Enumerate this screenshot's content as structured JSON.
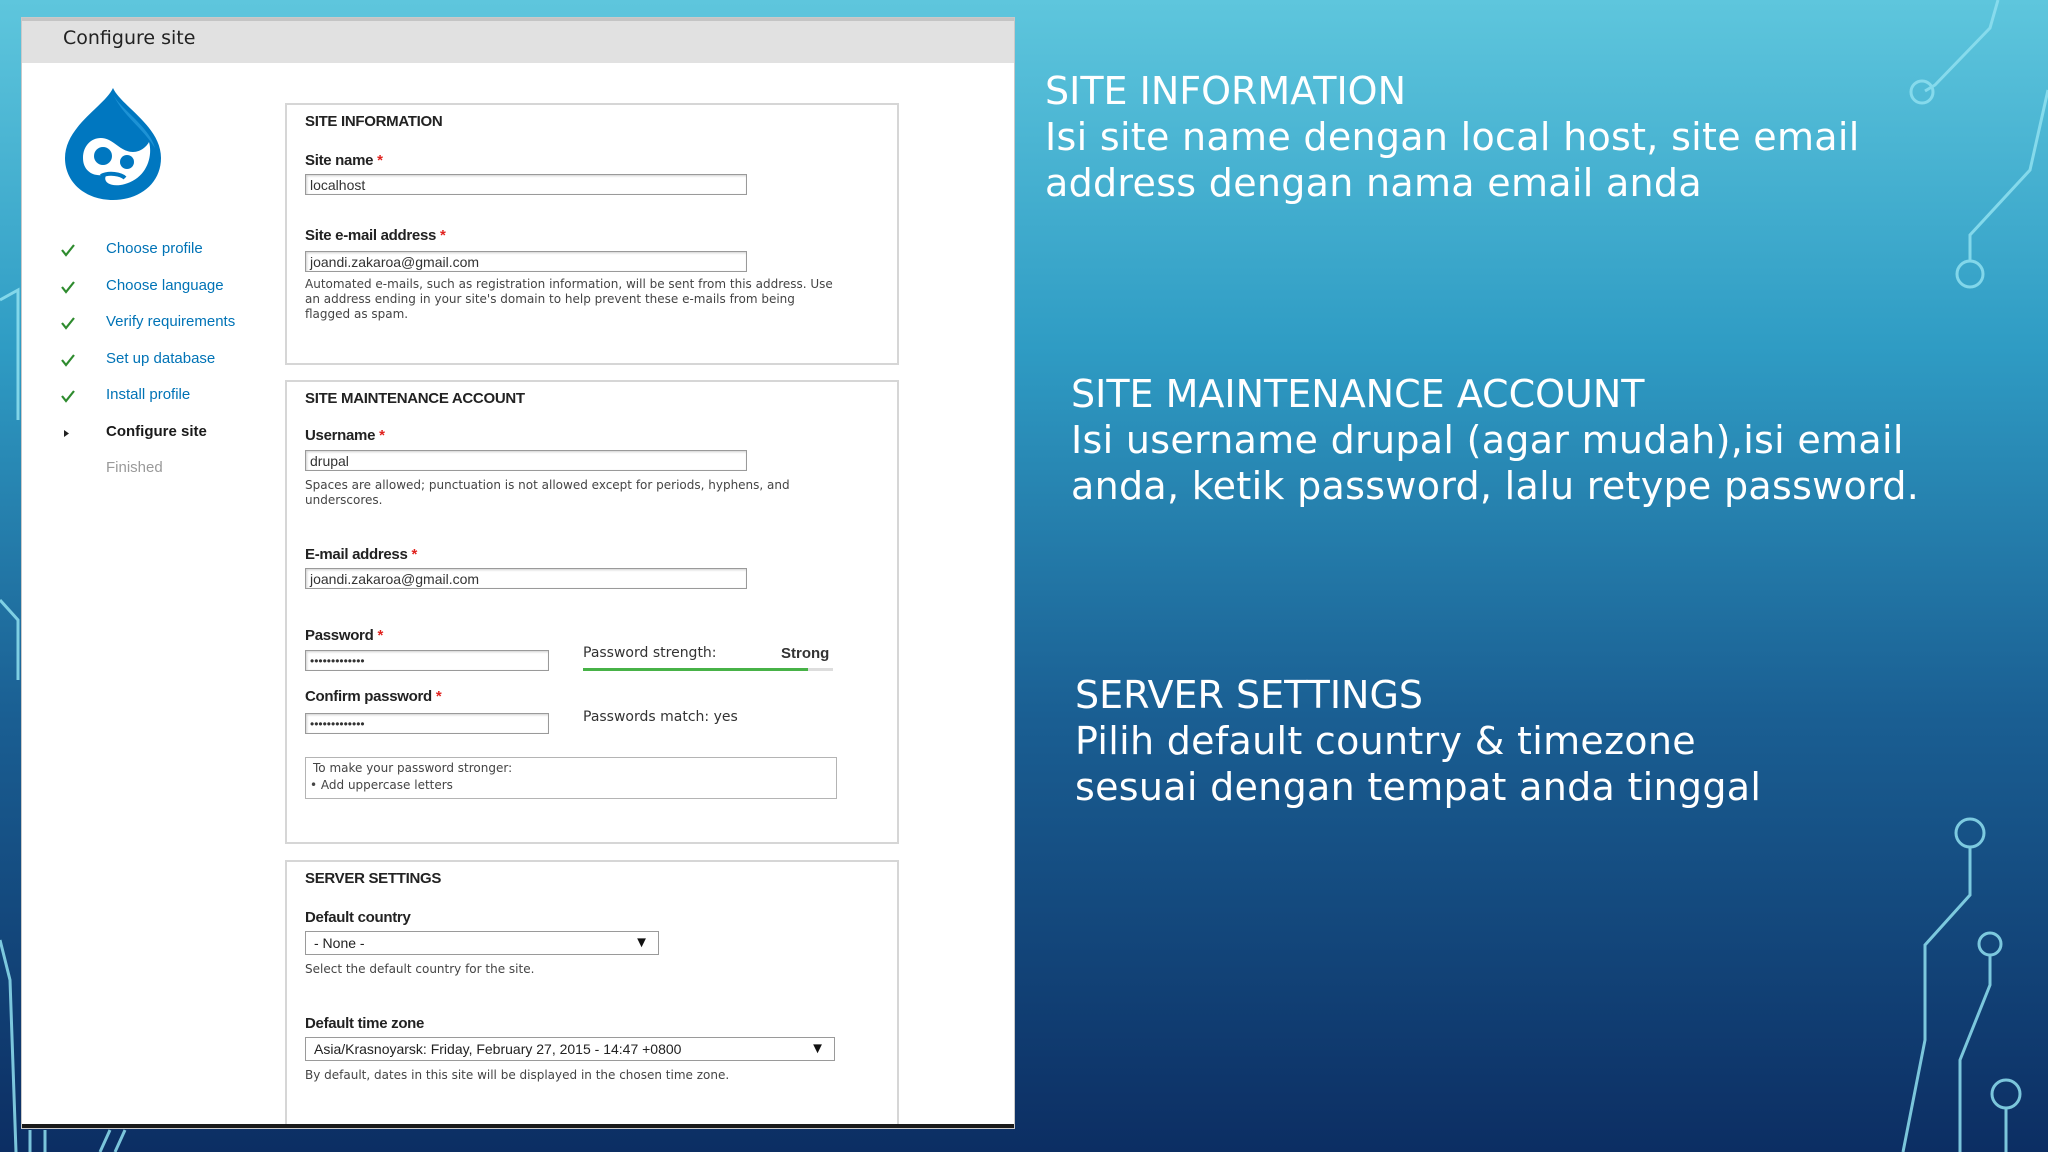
{
  "window": {
    "title": "Configure site"
  },
  "steps": [
    {
      "label": "Choose profile",
      "state": "done"
    },
    {
      "label": "Choose language",
      "state": "done"
    },
    {
      "label": "Verify requirements",
      "state": "done"
    },
    {
      "label": "Set up database",
      "state": "done"
    },
    {
      "label": "Install profile",
      "state": "done"
    },
    {
      "label": "Configure site",
      "state": "current"
    },
    {
      "label": "Finished",
      "state": "pending"
    }
  ],
  "site_information": {
    "legend": "SITE INFORMATION",
    "site_name_label": "Site name",
    "site_name_value": "localhost",
    "site_email_label": "Site e-mail address",
    "site_email_value": "joandi.zakaroa@gmail.com",
    "site_email_desc_1": "Automated e-mails, such as registration information, will be sent from this address. Use",
    "site_email_desc_2": "an address ending in your site's domain to help prevent these e-mails from being",
    "site_email_desc_3": "flagged as spam."
  },
  "maintenance": {
    "legend": "SITE MAINTENANCE ACCOUNT",
    "username_label": "Username",
    "username_value": "drupal",
    "username_desc_1": "Spaces are allowed; punctuation is not allowed except for periods, hyphens, and",
    "username_desc_2": "underscores.",
    "email_label": "E-mail address",
    "email_value": "joandi.zakaroa@gmail.com",
    "password_label": "Password",
    "password_value": "•••••••••••••",
    "strength_label": "Password strength:",
    "strength_value": "Strong",
    "strength_fill": 0.9,
    "confirm_label": "Confirm password",
    "confirm_value": "•••••••••••••",
    "match_text": "Passwords match: yes",
    "tip_title": "To make your password stronger:",
    "tip_item": "•    Add uppercase letters"
  },
  "server": {
    "legend": "SERVER SETTINGS",
    "country_label": "Default country",
    "country_value": "- None -",
    "country_desc": "Select the default country for the site.",
    "timezone_label": "Default time zone",
    "timezone_value": "Asia/Krasnoyarsk: Friday, February 27, 2015 - 14:47 +0800",
    "timezone_desc": "By default, dates in this site will be displayed in the chosen time zone.",
    "arrow": "▼"
  },
  "required_mark": "*",
  "notes": {
    "site_info_title": "SITE INFORMATION",
    "site_info_line1": "Isi site name dengan local host, site email",
    "site_info_line2": "address dengan nama email anda",
    "maint_title": "SITE MAINTENANCE ACCOUNT",
    "maint_line1": "Isi username drupal (agar mudah),isi email",
    "maint_line2": "anda, ketik password, lalu retype password.",
    "server_title": "SERVER SETTINGS",
    "server_line1": "Pilih default country & timezone",
    "server_line2": "sesuai dengan tempat anda tinggal"
  },
  "colors": {
    "link": "#0073b6",
    "required": "#e0221e",
    "strength_bar": "#47b247",
    "check": "#2e8b2e"
  },
  "icons": {
    "logo": "drupal-drop-logo",
    "done": "check-icon",
    "current": "triangle-right-icon"
  }
}
